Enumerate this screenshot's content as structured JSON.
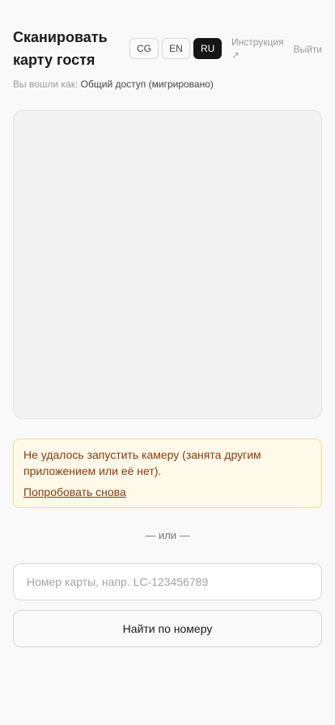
{
  "header": {
    "title": "Сканировать карту гостя",
    "languages": [
      {
        "code": "CG",
        "active": false
      },
      {
        "code": "EN",
        "active": false
      },
      {
        "code": "RU",
        "active": true
      }
    ],
    "instructions_label": "Инструкция ↗",
    "logout_label": "Выйти"
  },
  "login": {
    "prefix": "Вы вошли как:",
    "account": "Общий доступ (мигрировано)"
  },
  "alert": {
    "message": "Не удалось запустить камеру (занята другим приложением или её нет).",
    "retry_label": "Попробовать снова"
  },
  "divider": "— или —",
  "search": {
    "placeholder": "Номер карты, напр. LC-123456789",
    "value": "",
    "button_label": "Найти по номеру"
  },
  "colors": {
    "accent_active_lang": "#151515",
    "alert_background": "#fef9e8",
    "alert_border": "#f4dc8a",
    "alert_text": "#8a3b12"
  }
}
